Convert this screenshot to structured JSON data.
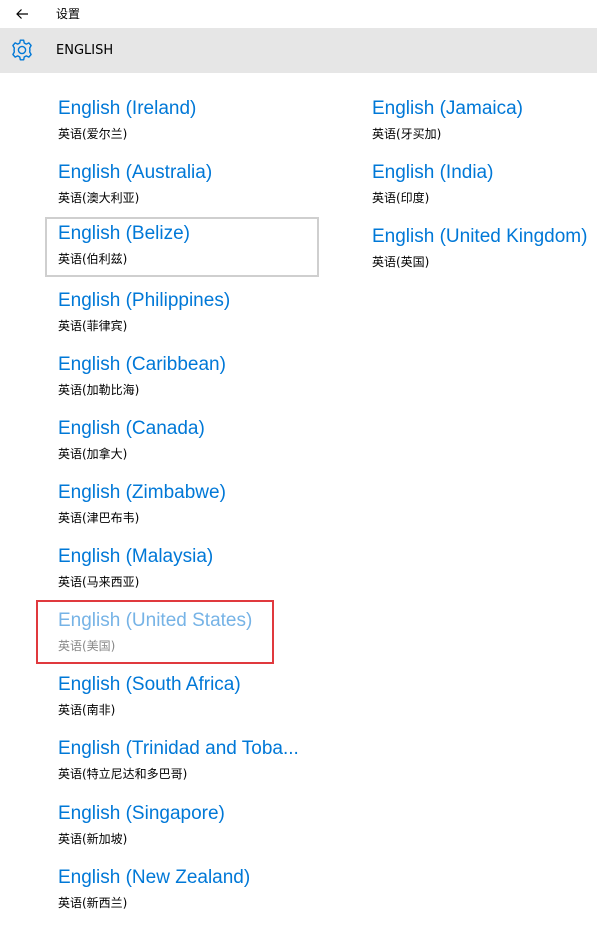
{
  "window": {
    "title": "设置"
  },
  "header": {
    "title": "ENGLISH"
  },
  "left_column": [
    {
      "name": "English (Ireland)",
      "native": "英语(爱尔兰)"
    },
    {
      "name": "English (Australia)",
      "native": "英语(澳大利亚)"
    },
    {
      "name": "English (Belize)",
      "native": "英语(伯利兹)"
    },
    {
      "name": "English (Philippines)",
      "native": "英语(菲律宾)"
    },
    {
      "name": "English (Caribbean)",
      "native": "英语(加勒比海)"
    },
    {
      "name": "English (Canada)",
      "native": "英语(加拿大)"
    },
    {
      "name": "English (Zimbabwe)",
      "native": "英语(津巴布韦)"
    },
    {
      "name": "English (Malaysia)",
      "native": "英语(马来西亚)"
    },
    {
      "name": "English (United States)",
      "native": "英语(美国)"
    },
    {
      "name": "English (South Africa)",
      "native": "英语(南非)"
    },
    {
      "name": "English (Trinidad and Toba...",
      "native": "英语(特立尼达和多巴哥)"
    },
    {
      "name": "English (Singapore)",
      "native": "英语(新加坡)"
    },
    {
      "name": "English (New Zealand)",
      "native": "英语(新西兰)"
    }
  ],
  "right_column": [
    {
      "name": "English (Jamaica)",
      "native": "英语(牙买加)"
    },
    {
      "name": "English (India)",
      "native": "英语(印度)"
    },
    {
      "name": "English (United Kingdom)",
      "native": "英语(英国)"
    }
  ],
  "colors": {
    "accent": "#0078d7",
    "disabled_accent": "#76b3e6",
    "header_bg": "#e6e6e6",
    "highlight": "#e0393e",
    "focus_border": "#cfcfcf"
  },
  "icons": {
    "back": "back-arrow-icon",
    "settings": "gear-icon"
  }
}
